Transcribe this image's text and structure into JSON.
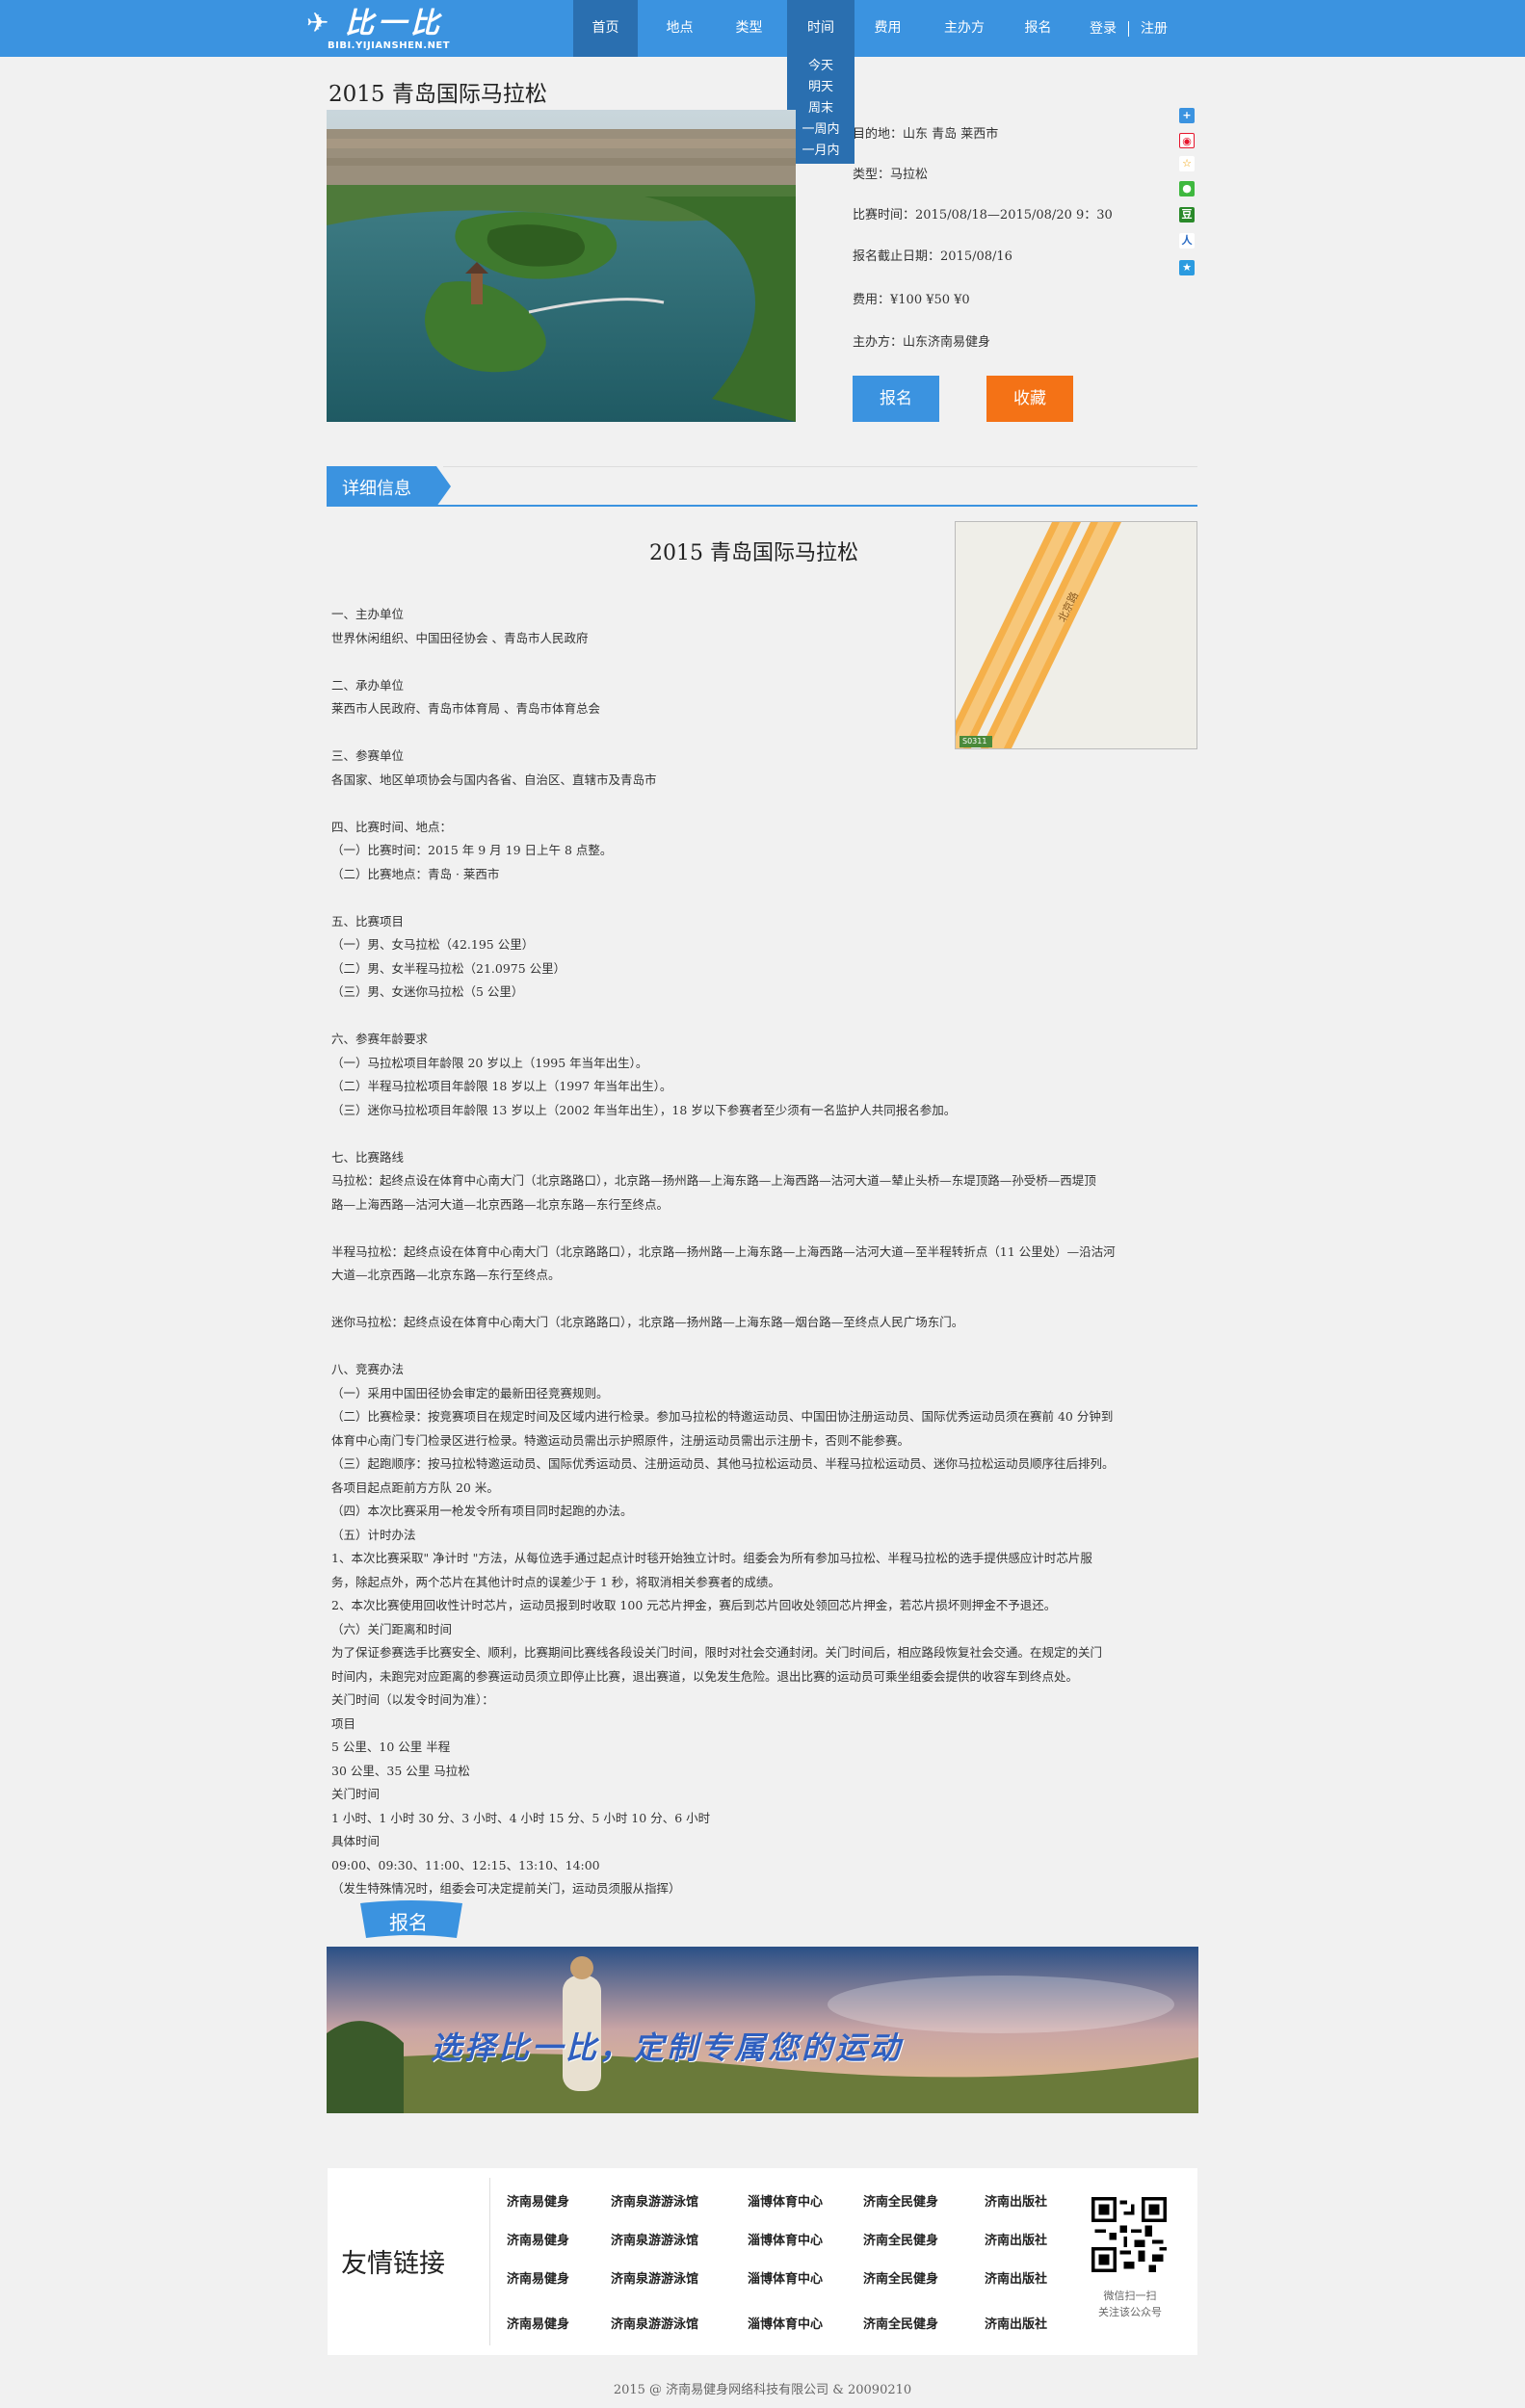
{
  "header": {
    "logo_text": "比一比",
    "logo_sub": "BIBI.YIJIANSHEN.NET",
    "nav": [
      "首页",
      "地点",
      "类型",
      "时间",
      "费用",
      "主办方",
      "报名"
    ],
    "time_dropdown": [
      "今天",
      "明天",
      "周末",
      "一周内",
      "一月内"
    ],
    "login": "登录",
    "register": "注册"
  },
  "event": {
    "title": "2015 青岛国际马拉松",
    "destination": "目的地：山东 青岛 莱西市",
    "type": "类型：马拉松",
    "time": "比赛时间：2015/08/18—2015/08/20 9：30",
    "deadline": "报名截止日期：2015/08/16",
    "fee": "费用：¥100 ¥50 ¥0",
    "organizer": "主办方：山东济南易健身",
    "signup_button": "报名",
    "favorite_button": "收藏"
  },
  "colors": {
    "primary": "#3b93e0",
    "nav_active": "#2a6fb0",
    "signup": "#3b93e0",
    "favorite": "#f47216"
  },
  "share_icons": [
    "add-share-icon",
    "weibo-icon",
    "star-share-icon",
    "wechat-icon",
    "douban-icon",
    "renren-icon",
    "qzone-icon"
  ],
  "detail": {
    "tab_label": "详细信息",
    "article_title": "2015 青岛国际马拉松",
    "map_road_label": "北京路",
    "map_shield": "S0311",
    "lines": [
      "一、主办单位",
      "世界休闲组织、中国田径协会 、青岛市人民政府",
      "",
      "二、承办单位",
      "莱西市人民政府、青岛市体育局 、青岛市体育总会",
      "",
      "三、参赛单位",
      "各国家、地区单项协会与国内各省、自治区、直辖市及青岛市",
      "",
      "四、比赛时间、地点：",
      "（一）比赛时间：2015 年 9 月 19 日上午 8 点整。",
      "（二）比赛地点：青岛 · 莱西市",
      "",
      "五、比赛项目",
      "（一）男、女马拉松（42.195 公里）",
      "（二）男、女半程马拉松（21.0975 公里）",
      "（三）男、女迷你马拉松（5 公里）",
      "",
      "六、参赛年龄要求",
      "（一）马拉松项目年龄限 20 岁以上（1995 年当年出生）。",
      "（二）半程马拉松项目年龄限 18 岁以上（1997 年当年出生）。",
      "（三）迷你马拉松项目年龄限 13 岁以上（2002 年当年出生），18 岁以下参赛者至少须有一名监护人共同报名参加。",
      "",
      "七、比赛路线",
      "马拉松：起终点设在体育中心南大门（北京路路口），北京路—扬州路—上海东路—上海西路—沽河大道—辇止头桥—东堤顶路—孙受桥—西堤顶",
      "路—上海西路—沽河大道—北京西路—北京东路—东行至终点。",
      "",
      "半程马拉松：起终点设在体育中心南大门（北京路路口），北京路—扬州路—上海东路—上海西路—沽河大道—至半程转折点（11 公里处）—沿沽河",
      "大道—北京西路—北京东路—东行至终点。",
      "",
      "迷你马拉松：起终点设在体育中心南大门（北京路路口），北京路—扬州路—上海东路—烟台路—至终点人民广场东门。",
      "",
      "八、竞赛办法",
      "（一）采用中国田径协会审定的最新田径竞赛规则。",
      "（二）比赛检录：按竞赛项目在规定时间及区域内进行检录。参加马拉松的特邀运动员、中国田协注册运动员、国际优秀运动员须在赛前 40 分钟到",
      "体育中心南门专门检录区进行检录。特邀运动员需出示护照原件，注册运动员需出示注册卡，否则不能参赛。",
      "（三）起跑顺序：按马拉松特邀运动员、国际优秀运动员、注册运动员、其他马拉松运动员、半程马拉松运动员、迷你马拉松运动员顺序往后排列。",
      "各项目起点距前方方队 20 米。",
      "（四）本次比赛采用一枪发令所有项目同时起跑的办法。",
      "（五）计时办法",
      "1、本次比赛采取\" 净计时 \"方法，从每位选手通过起点计时毯开始独立计时。组委会为所有参加马拉松、半程马拉松的选手提供感应计时芯片服",
      "务，除起点外，两个芯片在其他计时点的误差少于 1 秒，将取消相关参赛者的成绩。",
      "2、本次比赛使用回收性计时芯片，运动员报到时收取 100 元芯片押金，赛后到芯片回收处领回芯片押金，若芯片损坏则押金不予退还。",
      "（六）关门距离和时间",
      "为了保证参赛选手比赛安全、顺利，比赛期间比赛线各段设关门时间，限时对社会交通封闭。关门时间后，相应路段恢复社会交通。在规定的关门",
      "时间内，未跑完对应距离的参赛运动员须立即停止比赛，退出赛道，以免发生危险。退出比赛的运动员可乘坐组委会提供的收容车到终点处。",
      "关门时间（以发令时间为准）：",
      "项目",
      "5 公里、10 公里 半程",
      "30 公里、35 公里 马拉松",
      "关门时间",
      "1 小时、1 小时 30 分、3 小时、4 小时 15 分、5 小时 10 分、6 小时",
      "具体时间",
      "09:00、09:30、11:00、12:15、13:10、14:00",
      "（发生特殊情况时，组委会可决定提前关门，运动员须服从指挥）"
    ],
    "register_tag": "报名"
  },
  "banner": {
    "slogan": "选择比一比，定制专属您的运动"
  },
  "friend_links": {
    "title": "友情链接",
    "columns": [
      [
        "济南易健身",
        "济南易健身",
        "济南易健身",
        "济南易健身"
      ],
      [
        "济南泉游游泳馆",
        "济南泉游游泳馆",
        "济南泉游游泳馆",
        "济南泉游游泳馆"
      ],
      [
        "淄博体育中心",
        "淄博体育中心",
        "淄博体育中心",
        "淄博体育中心"
      ],
      [
        "济南全民健身",
        "济南全民健身",
        "济南全民健身",
        "济南全民健身"
      ],
      [
        "济南出版社",
        "济南出版社",
        "济南出版社",
        "济南出版社"
      ]
    ],
    "qr_caption_1": "微信扫一扫",
    "qr_caption_2": "关注该公众号"
  },
  "footer": {
    "copyright": "2015 @ 济南易健身网络科技有限公司 & 20090210"
  }
}
